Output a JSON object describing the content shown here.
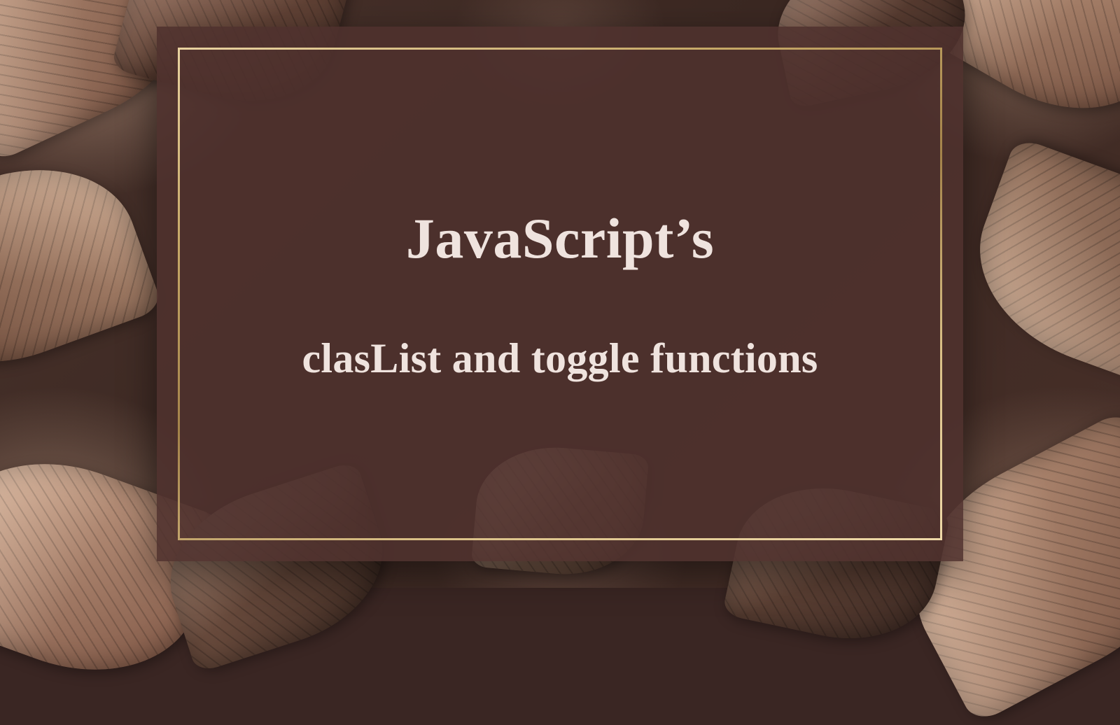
{
  "card": {
    "title": "JavaScript’s",
    "subtitle": "clasList and toggle functions"
  },
  "colors": {
    "text": "#efe3de",
    "panel": "rgba(78,49,45,0.88)",
    "frame_gradient": [
      "#e8d2a0",
      "#c7a968",
      "#a4834a",
      "#d9bf86",
      "#eed9a8"
    ]
  }
}
